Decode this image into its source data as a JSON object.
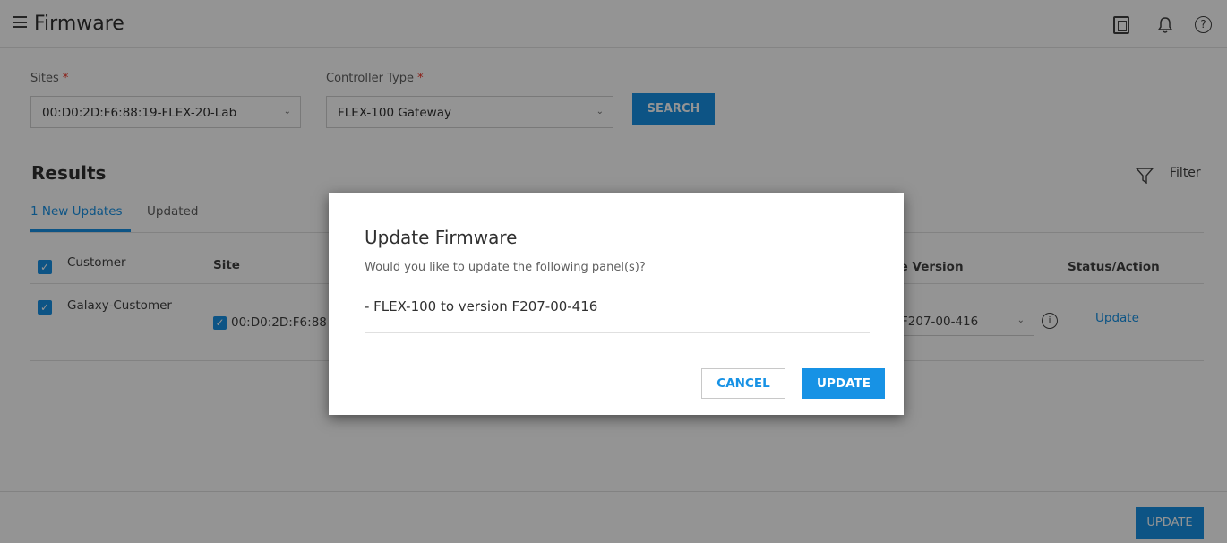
{
  "header": {
    "title": "Firmware",
    "help_glyph": "?"
  },
  "filters": {
    "sites_label": "Sites",
    "sites_required": "*",
    "sites_value": "00:D0:2D:F6:88:19-FLEX-20-Lab",
    "controller_label": "Controller Type",
    "controller_required": "*",
    "controller_value": "FLEX-100 Gateway",
    "search_label": "SEARCH"
  },
  "results": {
    "title": "Results",
    "filter_label": "Filter",
    "tabs": [
      {
        "label": "1 New Updates",
        "active": true
      },
      {
        "label": "Updated",
        "active": false
      }
    ],
    "columns": {
      "customer": "Customer",
      "site": "Site",
      "available_version": "le Version",
      "status_action": "Status/Action"
    },
    "row": {
      "customer": "Galaxy-Customer",
      "site": "00:D0:2D:F6:88",
      "version": "F207-00-416",
      "action": "Update",
      "info_glyph": "i"
    }
  },
  "footer": {
    "update_label": "UPDATE"
  },
  "modal": {
    "title": "Update Firmware",
    "subtitle": "Would you like to update the following panel(s)?",
    "item": "- FLEX-100 to version F207-00-416",
    "cancel_label": "CANCEL",
    "update_label": "UPDATE"
  },
  "colors": {
    "accent": "#1792e5",
    "required": "#ee3124",
    "overlay": "rgba(0,0,0,0.42)"
  }
}
